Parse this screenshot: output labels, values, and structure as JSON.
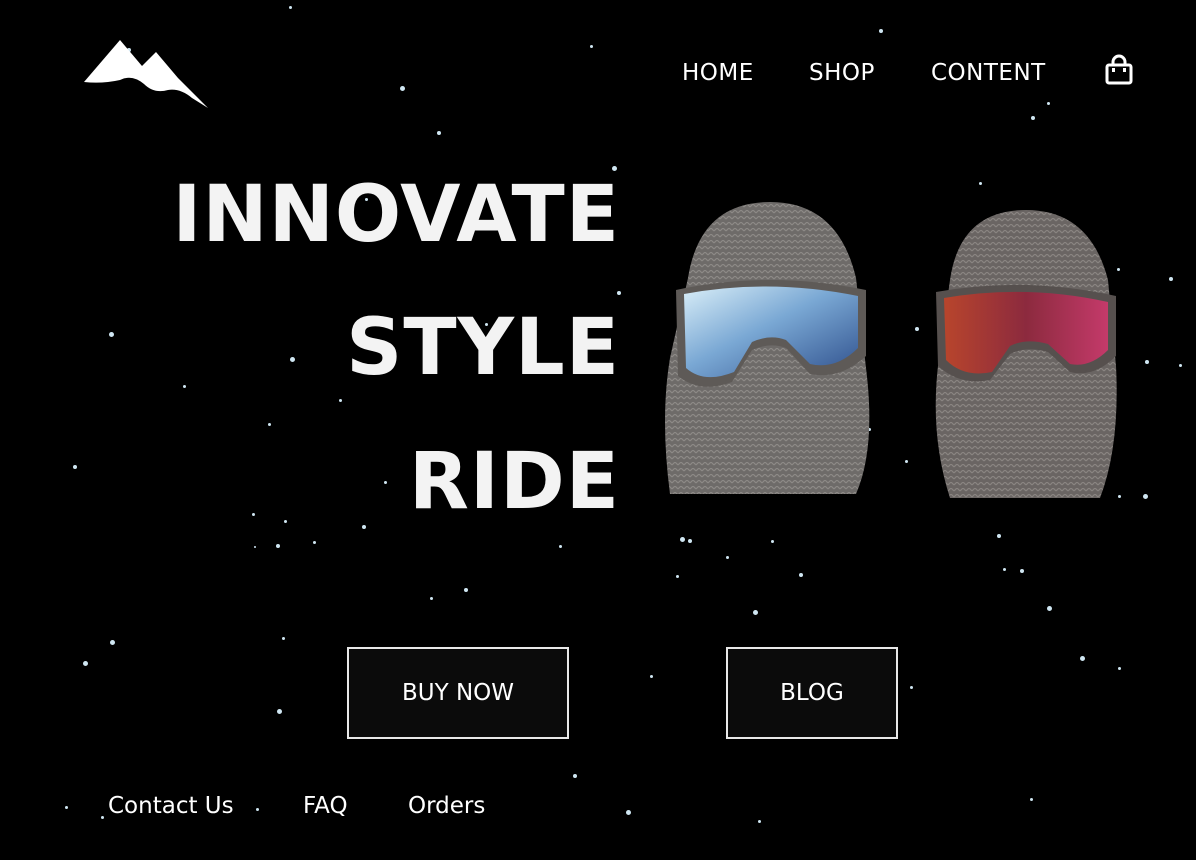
{
  "header": {
    "logo_icon": "mountain-icon",
    "nav": [
      {
        "label": "HOME"
      },
      {
        "label": "SHOP"
      },
      {
        "label": "CONTENT"
      }
    ],
    "cart_icon": "shopping-bag-icon"
  },
  "hero": {
    "lines": [
      "INNOVATE",
      "STYLE",
      "RIDE"
    ]
  },
  "products": [
    {
      "icon": "balaclava-blue-goggles-image"
    },
    {
      "icon": "balaclava-red-goggles-image"
    }
  ],
  "actions": {
    "buy_now": "BUY NOW",
    "blog": "BLOG"
  },
  "footer": {
    "links": [
      "Contact Us",
      "FAQ",
      "Orders"
    ]
  },
  "colors": {
    "background": "#000000",
    "text": "#ffffff",
    "snow": "#cfe6f2",
    "button_border": "#e8e8e8"
  }
}
